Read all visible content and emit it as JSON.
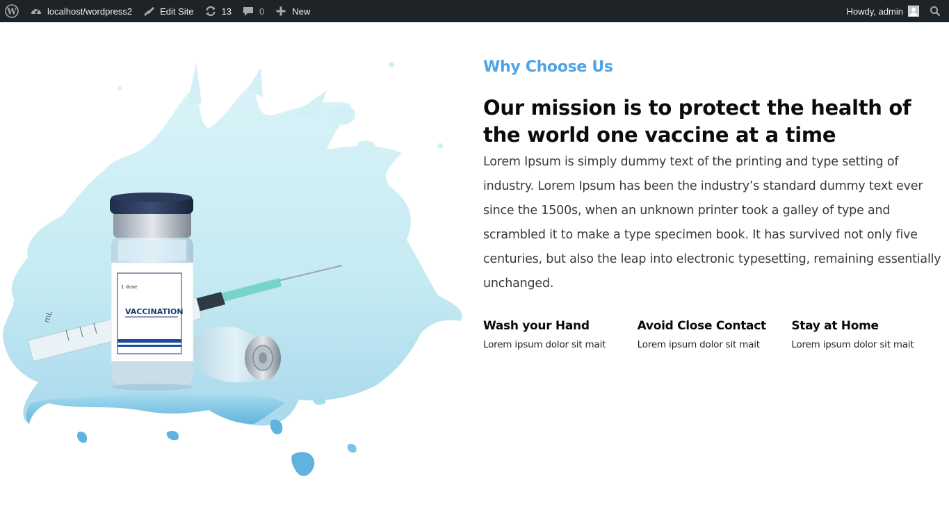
{
  "adminbar": {
    "site_url": "localhost/wordpress2",
    "edit_site": "Edit Site",
    "updates_count": "13",
    "comments_count": "0",
    "new_label": "New",
    "greeting": "Howdy, admin"
  },
  "hero_image": {
    "label_dose": "1 dose",
    "label_name": "VACCINATION",
    "syringe_mark": "mL"
  },
  "section": {
    "eyebrow": "Why Choose Us",
    "headline": "Our mission is to protect the health of the world one vaccine at a time",
    "body": "Lorem Ipsum is simply dummy text of the printing and type setting of industry. Lorem Ipsum has been the industry’s standard dummy text ever since the 1500s, when an unknown printer took a galley of type and scrambled it to make a type specimen book. It has survived not only five centuries, but also the leap into electronic typesetting, remaining essentially unchanged.",
    "features": [
      {
        "title": "Wash your Hand",
        "text": "Lorem ipsum dolor sit mait"
      },
      {
        "title": "Avoid Close Contact",
        "text": "Lorem ipsum dolor sit mait"
      },
      {
        "title": "Stay at Home",
        "text": "Lorem ipsum dolor sit mait"
      }
    ]
  },
  "colors": {
    "adminbar_bg": "#1d2327",
    "accent": "#4ea4e5",
    "splash": "#c9ecf3"
  }
}
